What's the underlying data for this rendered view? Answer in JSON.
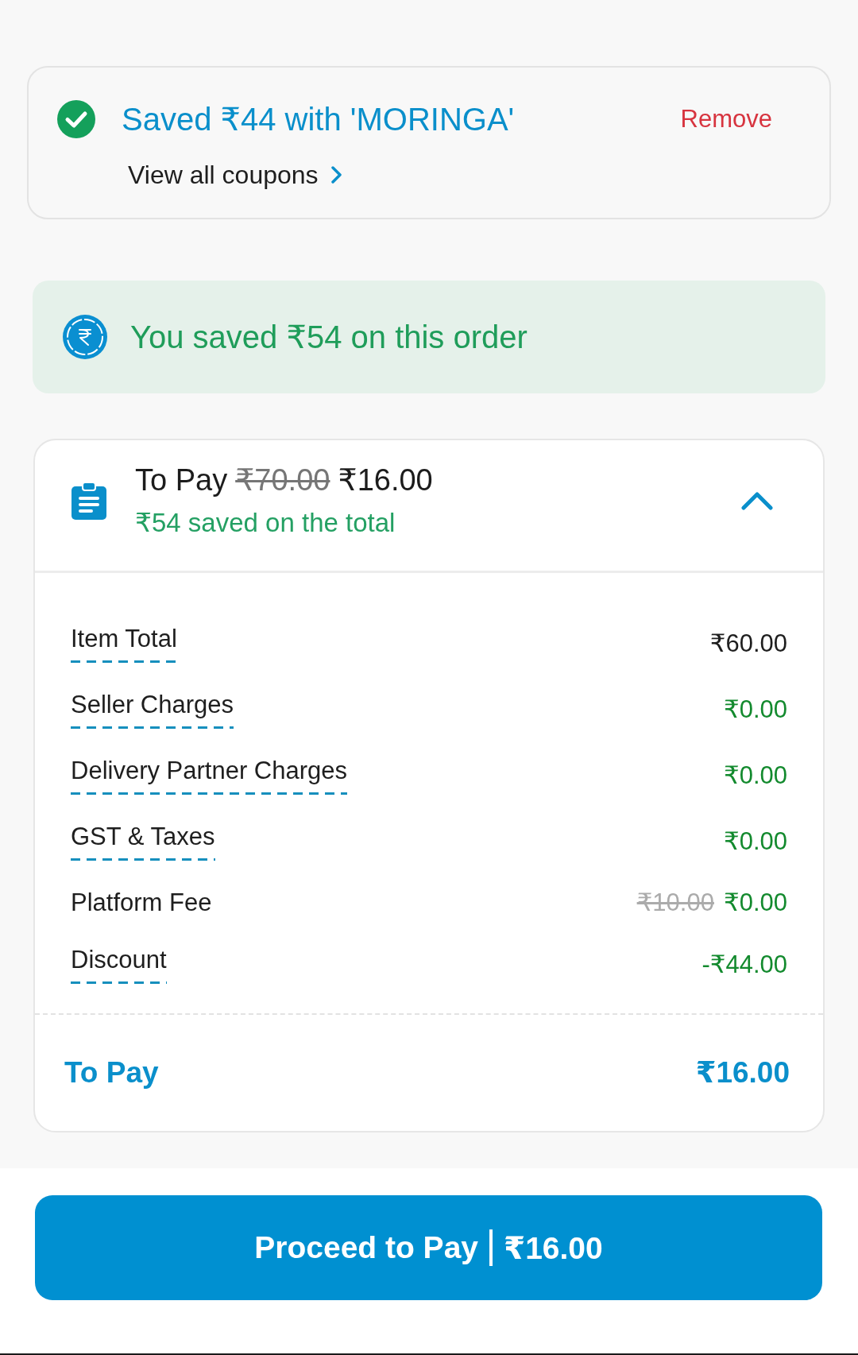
{
  "coupon": {
    "title": "Saved ₹44 with 'MORINGA'",
    "action": "Remove",
    "link": "View all coupons"
  },
  "savings_banner": {
    "text": "You saved ₹54 on this order"
  },
  "bill": {
    "title": "To Pay",
    "original_total": "₹70.00",
    "total": "₹16.00",
    "savings_note": "₹54 saved on the total",
    "expanded": true,
    "rows": [
      {
        "label": "Item Total",
        "value": "₹60.00",
        "kind": "charge",
        "has_info": true
      },
      {
        "label": "Seller Charges",
        "value": "₹0.00",
        "kind": "saving",
        "has_info": true
      },
      {
        "label": "Delivery Partner Charges",
        "value": "₹0.00",
        "kind": "saving",
        "has_info": true
      },
      {
        "label": "GST & Taxes",
        "value": "₹0.00",
        "kind": "saving",
        "has_info": true
      },
      {
        "label": "Platform Fee",
        "original_value": "₹10.00",
        "value": "₹0.00",
        "kind": "saving",
        "has_info": false
      },
      {
        "label": "Discount",
        "value": "-₹44.00",
        "kind": "saving",
        "has_info": true
      }
    ],
    "summary": {
      "label": "To Pay",
      "value": "₹16.00"
    }
  },
  "pay_button": {
    "label": "Proceed to Pay",
    "amount": "₹16.00"
  }
}
